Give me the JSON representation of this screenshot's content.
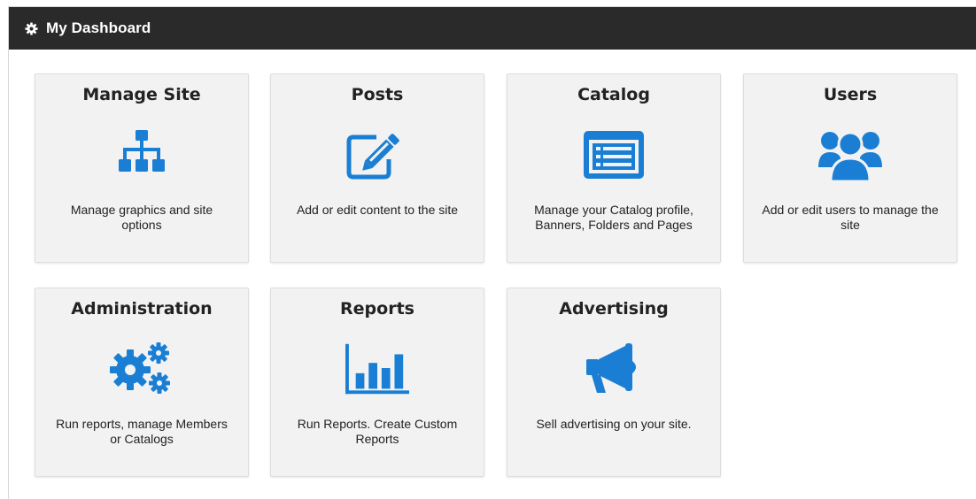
{
  "header": {
    "title": "My Dashboard",
    "icon": "gear-icon"
  },
  "accent_color": "#1a7fd4",
  "tiles": [
    {
      "title": "Manage Site",
      "icon": "sitemap-icon",
      "desc": "Manage graphics and site options"
    },
    {
      "title": "Posts",
      "icon": "edit-icon",
      "desc": "Add or edit content to the site"
    },
    {
      "title": "Catalog",
      "icon": "list-alt-icon",
      "desc": "Manage your Catalog profile, Banners, Folders and Pages"
    },
    {
      "title": "Users",
      "icon": "users-icon",
      "desc": "Add or edit users to manage the site"
    },
    {
      "title": "Administration",
      "icon": "gears-icon",
      "desc": "Run reports, manage Members or Catalogs"
    },
    {
      "title": "Reports",
      "icon": "bar-chart-icon",
      "desc": "Run Reports. Create Custom Reports"
    },
    {
      "title": "Advertising",
      "icon": "bullhorn-icon",
      "desc": "Sell advertising on your site."
    }
  ]
}
